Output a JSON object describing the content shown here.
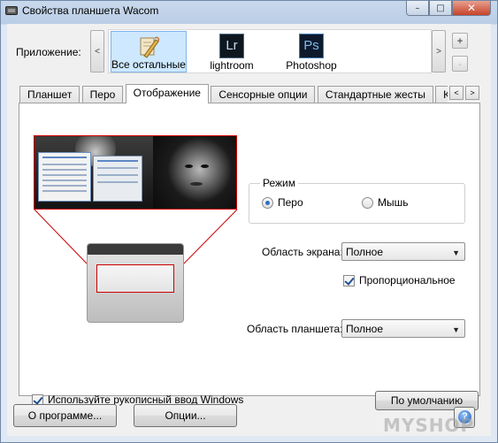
{
  "window": {
    "title": "Свойства планшета Wacom",
    "close_label": "✕",
    "min_label": "–",
    "max_label": "□"
  },
  "apps": {
    "label": "Приложение:",
    "left_arrow": "<",
    "right_arrow": ">",
    "items": [
      {
        "label": "Все остальные",
        "icon": "all-apps-icon",
        "selected": true
      },
      {
        "label": "lightroom",
        "icon_text": "Lr"
      },
      {
        "label": "Photoshop",
        "icon_text": "Ps"
      }
    ],
    "add_label": "+",
    "remove_label": "-"
  },
  "tabs": [
    {
      "label": "Планшет"
    },
    {
      "label": "Перо"
    },
    {
      "label": "Отображение",
      "active": true
    },
    {
      "label": "Сенсорные опции"
    },
    {
      "label": "Стандартные жесты"
    },
    {
      "label": "Кру"
    }
  ],
  "tab_scroll": {
    "left": "<",
    "right": ">"
  },
  "mode": {
    "title": "Режим",
    "options": [
      {
        "label": "Перо",
        "selected": true
      },
      {
        "label": "Мышь",
        "selected": false
      }
    ]
  },
  "screen_area": {
    "label": "Область экрана:",
    "value": "Полное"
  },
  "proportional": {
    "label": "Пропорциональное",
    "checked": true
  },
  "tablet_area": {
    "label": "Область планшета:",
    "value": "Полное"
  },
  "windows_ink": {
    "label": "Используйте рукописный ввод Windows",
    "checked": true
  },
  "buttons": {
    "default": "По умолчанию",
    "about": "О программе...",
    "options": "Опции...",
    "help": "?"
  },
  "watermark": "MYSHOP",
  "colors": {
    "mapping_red": "#cc0000",
    "selection_blue": "#cde8ff"
  }
}
